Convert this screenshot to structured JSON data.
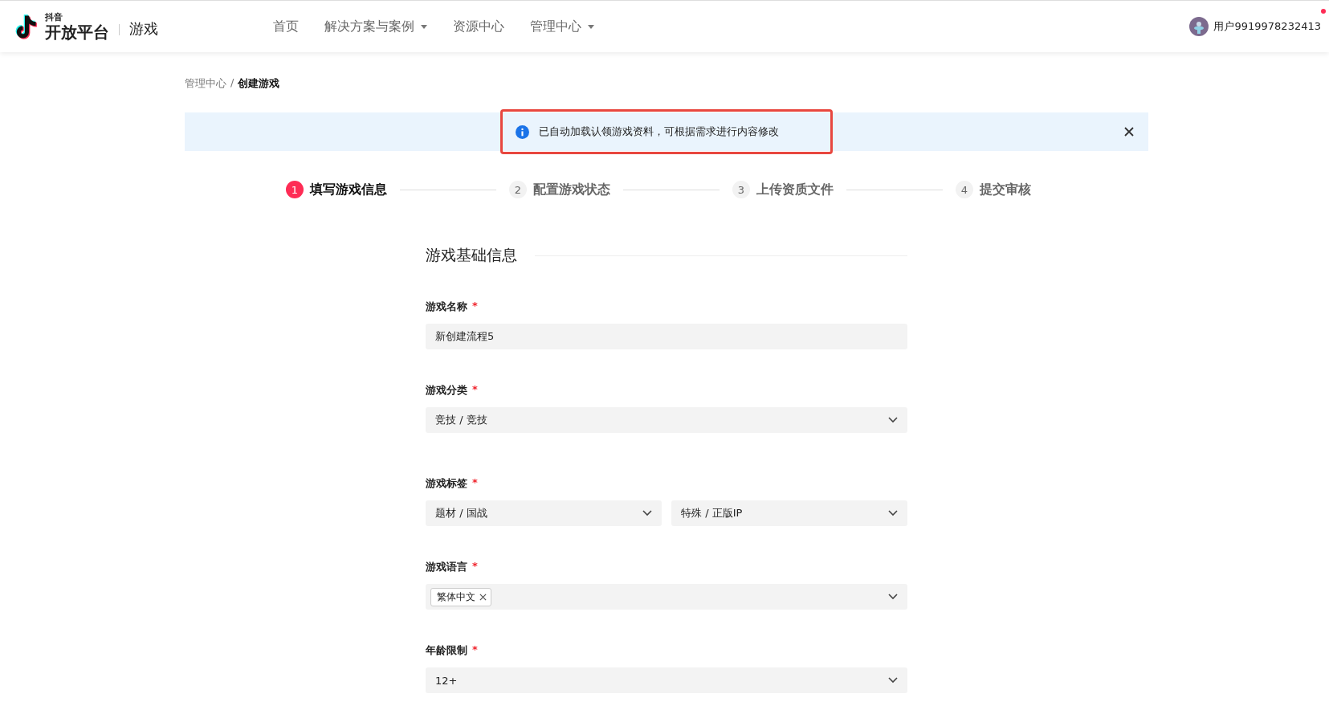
{
  "header": {
    "logo_small": "抖音",
    "logo_main": "开放平台",
    "section": "游戏",
    "nav": [
      {
        "label": "首页",
        "dropdown": false
      },
      {
        "label": "解决方案与案例",
        "dropdown": true
      },
      {
        "label": "资源中心",
        "dropdown": false
      },
      {
        "label": "管理中心",
        "dropdown": true
      }
    ],
    "user": {
      "name": "用户9919978232413",
      "unread": true
    }
  },
  "breadcrumb": [
    {
      "label": "管理中心",
      "current": false
    },
    {
      "label": "创建游戏",
      "current": true
    }
  ],
  "breadcrumb_separator": "/",
  "alert": {
    "text": "已自动加载认领游戏资料，可根据需求进行内容修改",
    "highlighted": true
  },
  "steps": [
    {
      "number": "1",
      "label": "填写游戏信息",
      "selected": true
    },
    {
      "number": "2",
      "label": "配置游戏状态",
      "selected": false
    },
    {
      "number": "3",
      "label": "上传资质文件",
      "selected": false
    },
    {
      "number": "4",
      "label": "提交审核",
      "selected": false
    }
  ],
  "section_title": "游戏基础信息",
  "fields": [
    {
      "kind": "text",
      "label": "游戏名称",
      "required_mark": "*",
      "value": "新创建流程5"
    },
    {
      "kind": "select",
      "label": "游戏分类",
      "required_mark": "*",
      "value": "竞技 / 竞技"
    },
    {
      "kind": "select_pair",
      "label": "游戏标签",
      "required_mark": "*",
      "values": [
        "题材 / 国战",
        "特殊 / 正版IP"
      ]
    },
    {
      "kind": "tags",
      "label": "游戏语言",
      "required_mark": "*",
      "tags": [
        "繁体中文"
      ]
    },
    {
      "kind": "select",
      "label": "年龄限制",
      "required_mark": "*",
      "value": "12+"
    }
  ]
}
